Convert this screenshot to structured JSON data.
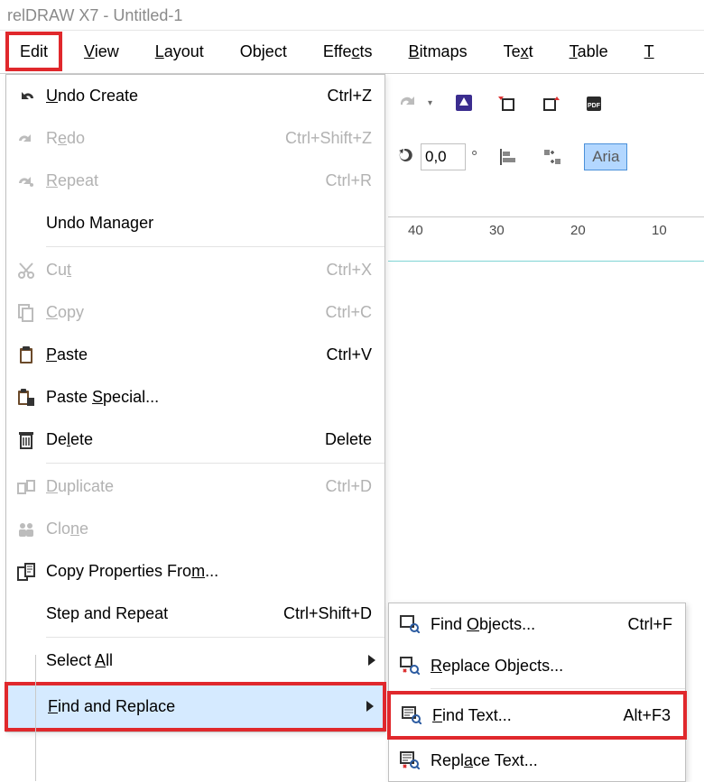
{
  "title": "relDRAW X7 - Untitled-1",
  "menu": {
    "edit": "Edit",
    "view": "View",
    "layout": "Layout",
    "object": "Object",
    "effects": "Effects",
    "bitmaps": "Bitmaps",
    "text": "Text",
    "table": "Table",
    "tools_partial": "T"
  },
  "toolbar": {
    "rotation_value": "0,0",
    "rotation_unit": "°",
    "font_preview": "Aria"
  },
  "ruler": {
    "r40": "40",
    "r30": "30",
    "r20": "20",
    "r10": "10"
  },
  "edit_menu": {
    "undo": {
      "label": "Undo Create",
      "shortcut": "Ctrl+Z"
    },
    "redo": {
      "label": "Redo",
      "shortcut": "Ctrl+Shift+Z"
    },
    "repeat": {
      "label": "Repeat",
      "shortcut": "Ctrl+R"
    },
    "undo_mgr": {
      "label": "Undo Manager"
    },
    "cut": {
      "label": "Cut",
      "shortcut": "Ctrl+X"
    },
    "copy": {
      "label": "Copy",
      "shortcut": "Ctrl+C"
    },
    "paste": {
      "label": "Paste",
      "shortcut": "Ctrl+V"
    },
    "paste_sp": {
      "label": "Paste Special..."
    },
    "delete": {
      "label": "Delete",
      "shortcut": "Delete"
    },
    "duplicate": {
      "label": "Duplicate",
      "shortcut": "Ctrl+D"
    },
    "clone": {
      "label": "Clone"
    },
    "copy_props": {
      "label": "Copy Properties From..."
    },
    "step_repeat": {
      "label": "Step and Repeat",
      "shortcut": "Ctrl+Shift+D"
    },
    "select_all": {
      "label": "Select All"
    },
    "find_replace": {
      "label": "Find and Replace"
    }
  },
  "find_replace_sub": {
    "find_obj": {
      "label": "Find Objects...",
      "shortcut": "Ctrl+F"
    },
    "replace_obj": {
      "label": "Replace Objects..."
    },
    "find_text": {
      "label": "Find Text...",
      "shortcut": "Alt+F3"
    },
    "replace_text": {
      "label": "Replace Text..."
    }
  }
}
